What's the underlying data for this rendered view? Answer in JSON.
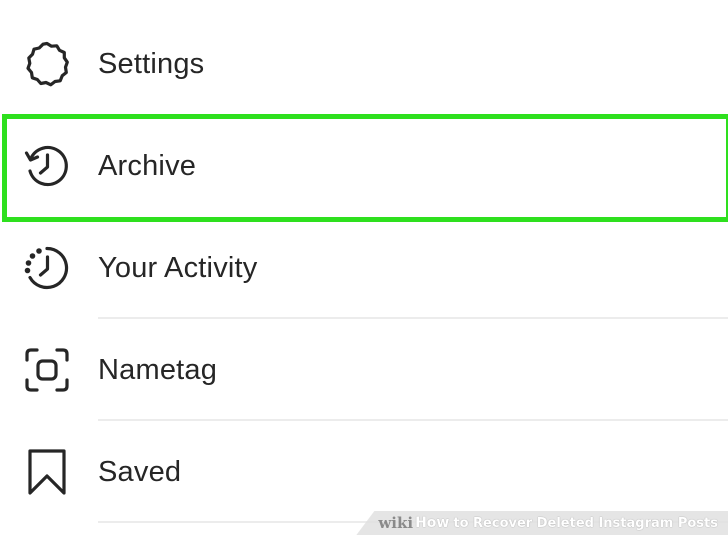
{
  "menu": {
    "items": [
      {
        "label": "Settings",
        "icon": "gear-icon"
      },
      {
        "label": "Archive",
        "icon": "archive-clock-icon"
      },
      {
        "label": "Your Activity",
        "icon": "activity-clock-icon"
      },
      {
        "label": "Nametag",
        "icon": "nametag-scan-icon"
      },
      {
        "label": "Saved",
        "icon": "bookmark-icon"
      }
    ]
  },
  "highlight": {
    "color": "#2ee01e",
    "target": "Archive"
  },
  "watermark": {
    "wiki": "wiki",
    "how": "How",
    "rest": "to Recover Deleted Instagram Posts"
  },
  "colors": {
    "text": "#262626",
    "divider": "#ececec",
    "background": "#ffffff"
  }
}
